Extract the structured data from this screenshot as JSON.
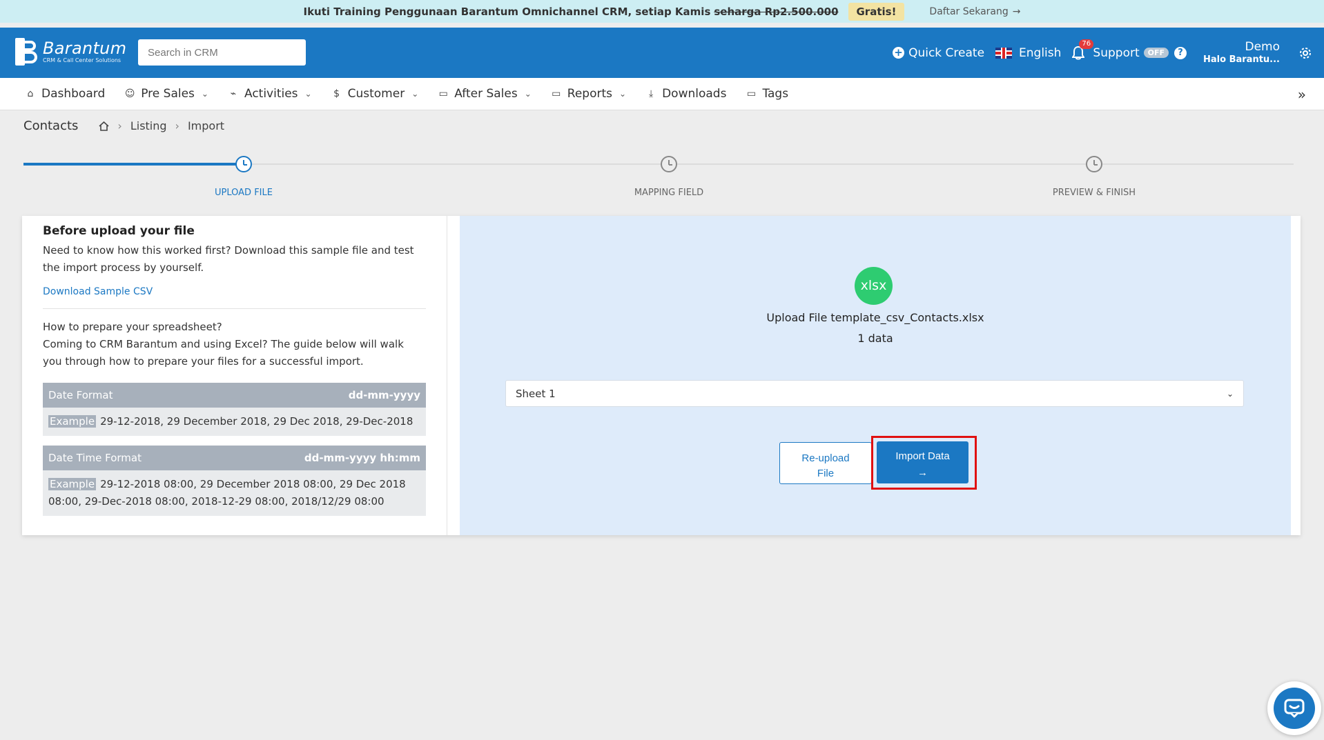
{
  "promo": {
    "text": "Ikuti Training Penggunaan Barantum Omnichannel CRM, setiap Kamis",
    "old_price": "seharga Rp2.500.000",
    "badge": "Gratis!",
    "cta": "Daftar Sekarang",
    "cta_arrow": "→"
  },
  "header": {
    "brand": "Barantum",
    "tagline": "CRM & Call Center Solutions",
    "search_placeholder": "Search in CRM",
    "quick_create": "Quick Create",
    "language": "English",
    "notif_count": "76",
    "support": "Support",
    "support_status": "OFF",
    "user_name": "Demo",
    "user_sub": "Halo Barantu..."
  },
  "nav": {
    "items": [
      {
        "label": "Dashboard",
        "icon": "home-icon",
        "dropdown": false
      },
      {
        "label": "Pre Sales",
        "icon": "users-icon",
        "dropdown": true
      },
      {
        "label": "Activities",
        "icon": "activity-icon",
        "dropdown": true
      },
      {
        "label": "Customer",
        "icon": "dollar-icon",
        "dropdown": true
      },
      {
        "label": "After Sales",
        "icon": "folder-icon",
        "dropdown": true
      },
      {
        "label": "Reports",
        "icon": "folder-icon",
        "dropdown": true
      },
      {
        "label": "Downloads",
        "icon": "download-icon",
        "dropdown": false
      },
      {
        "label": "Tags",
        "icon": "folder-icon",
        "dropdown": false
      }
    ],
    "expand": "»"
  },
  "breadcrumb": {
    "title": "Contacts",
    "items": [
      "Listing",
      "Import"
    ]
  },
  "steps": [
    {
      "label": "UPLOAD FILE",
      "active": true
    },
    {
      "label": "MAPPING FIELD",
      "active": false
    },
    {
      "label": "PREVIEW & FINISH",
      "active": false
    }
  ],
  "left_panel": {
    "heading": "Before upload your file",
    "intro": "Need to know how this worked first? Download this sample file and test the import process by yourself.",
    "download_link": "Download Sample CSV",
    "prepare_q": "How to prepare your spreadsheet?",
    "prepare_text": "Coming to CRM Barantum and using Excel? The guide below will walk you through how to prepare your files for a successful import.",
    "date_format": {
      "label": "Date Format",
      "value": "dd-mm-yyyy",
      "example_label": "Example",
      "example": "29-12-2018, 29 December 2018, 29 Dec 2018, 29-Dec-2018"
    },
    "datetime_format": {
      "label": "Date Time Format",
      "value": "dd-mm-yyyy hh:mm",
      "example_label": "Example",
      "example": "29-12-2018 08:00, 29 December 2018 08:00, 29 Dec 2018 08:00, 29-Dec-2018 08:00, 2018-12-29 08:00, 2018/12/29 08:00"
    }
  },
  "right_panel": {
    "file_badge": "xlsx",
    "upload_text": "Upload File template_csv_Contacts.xlsx",
    "count_text": "1 data",
    "sheet_selected": "Sheet 1",
    "reupload_label_1": "Re-upload",
    "reupload_label_2": "File",
    "import_label": "Import Data",
    "import_arrow": "→"
  },
  "colors": {
    "brand": "#1b78c3",
    "promo_bg": "#cdeef3",
    "badge_green": "#2ecc71",
    "highlight": "#e01010"
  }
}
